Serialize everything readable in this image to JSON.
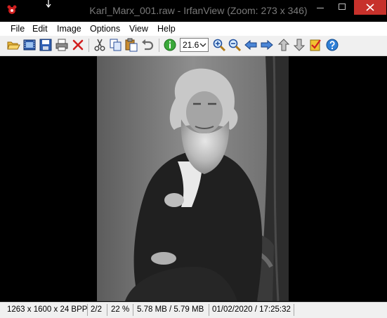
{
  "window": {
    "title": "Karl_Marx_001.raw - IrfanView (Zoom: 273 x 346)",
    "accent_close": "#c7312b"
  },
  "menu": [
    "File",
    "Edit",
    "Image",
    "Options",
    "View",
    "Help"
  ],
  "toolbar": {
    "zoom_value": "21.6",
    "buttons": [
      "open-folder-icon",
      "slideshow-icon",
      "save-icon",
      "print-icon",
      "delete-icon",
      "cut-icon",
      "copy-icon",
      "paste-icon",
      "undo-icon",
      "info-icon",
      "zoom-in-icon",
      "zoom-out-icon",
      "previous-icon",
      "next-icon",
      "first-file-icon",
      "last-file-icon",
      "checklist-icon",
      "help-icon"
    ]
  },
  "status": {
    "dimensions": "1263 x 1600 x 24 BPP",
    "index": "2/2",
    "zoom": "22 %",
    "size": "5.78 MB / 5.79 MB",
    "datetime": "01/02/2020 / 17:25:32"
  }
}
